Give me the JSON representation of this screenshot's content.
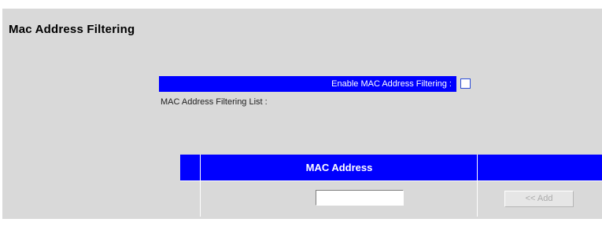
{
  "page": {
    "title": "Mac Address Filtering"
  },
  "filter": {
    "enable_label": "Enable MAC Address Filtering :",
    "enabled": false,
    "list_label": "MAC Address Filtering List :"
  },
  "table": {
    "columns": [
      "",
      "MAC Address",
      ""
    ],
    "row": {
      "mac_value": "",
      "add_label": "<< Add",
      "add_enabled": false
    }
  },
  "colors": {
    "header_blue": "#0000ff",
    "panel_gray": "#d9d9d9"
  }
}
